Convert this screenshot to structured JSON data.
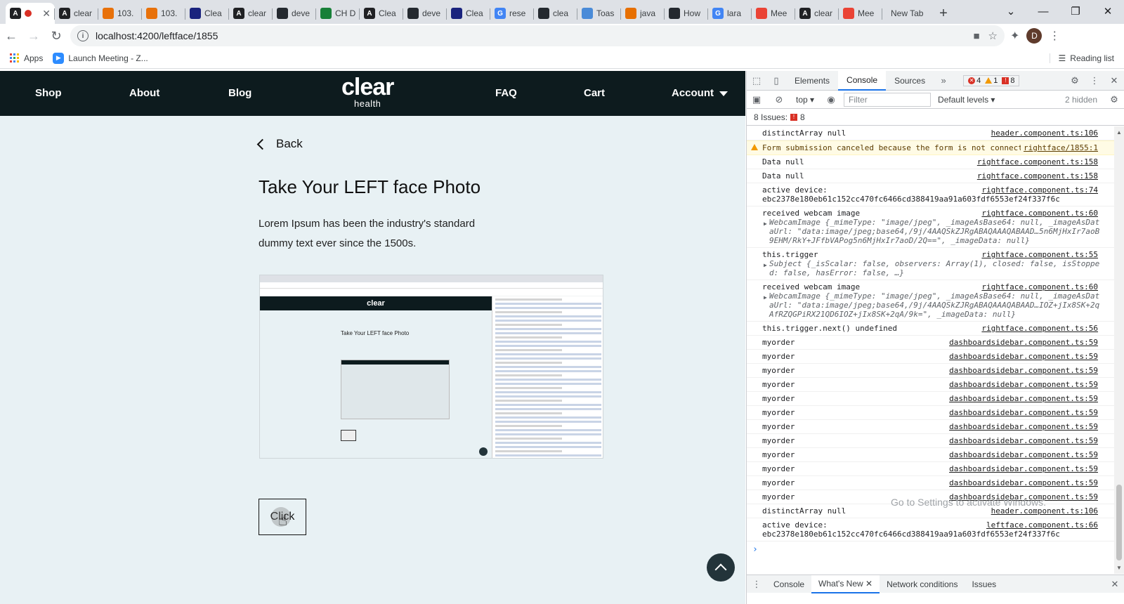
{
  "browser": {
    "tabs": [
      {
        "label": "",
        "icon": "A",
        "color": "#202124"
      },
      {
        "label": "clear",
        "icon": "A",
        "color": "#202124"
      },
      {
        "label": "103.",
        "icon": "",
        "color": "#e8710a"
      },
      {
        "label": "103.",
        "icon": "",
        "color": "#e8710a"
      },
      {
        "label": "Clea",
        "icon": "",
        "color": "#1a237e"
      },
      {
        "label": "clear",
        "icon": "A",
        "color": "#202124"
      },
      {
        "label": "deve",
        "icon": "",
        "color": "#24292f"
      },
      {
        "label": "CH D",
        "icon": "",
        "color": "#188038"
      },
      {
        "label": "Clea",
        "icon": "A",
        "color": "#202124"
      },
      {
        "label": "deve",
        "icon": "",
        "color": "#24292f"
      },
      {
        "label": "Clea",
        "icon": "",
        "color": "#1a237e"
      },
      {
        "label": "rese",
        "icon": "G",
        "color": "#4285f4"
      },
      {
        "label": "clea",
        "icon": "",
        "color": "#24292f"
      },
      {
        "label": "Toas",
        "icon": "",
        "color": "#4a8bd8"
      },
      {
        "label": "java",
        "icon": "",
        "color": "#e76f00"
      },
      {
        "label": "How",
        "icon": "",
        "color": "#24292f"
      },
      {
        "label": "lara",
        "icon": "G",
        "color": "#4285f4"
      },
      {
        "label": "Mee",
        "icon": "",
        "color": "#ea4335"
      },
      {
        "label": "clear",
        "icon": "A",
        "color": "#202124"
      },
      {
        "label": "Mee",
        "icon": "",
        "color": "#ea4335"
      }
    ],
    "new_tab_label": "New Tab",
    "url": "localhost:4200/leftface/1855",
    "avatar_letter": "D",
    "bookmarks": {
      "apps": "Apps",
      "meeting": "Launch Meeting - Z...",
      "reading_list": "Reading list"
    }
  },
  "site": {
    "nav": {
      "shop": "Shop",
      "about": "About",
      "blog": "Blog",
      "logo_big": "clear",
      "logo_small": "health",
      "faq": "FAQ",
      "cart": "Cart",
      "account": "Account"
    },
    "back_label": "Back",
    "heading": "Take Your LEFT face Photo",
    "description": "Lorem Ipsum has been the industry's standard dummy text ever since the 1500s.",
    "click_button": "Click"
  },
  "devtools": {
    "tabs": [
      "Elements",
      "Console",
      "Sources"
    ],
    "active_tab": "Console",
    "error_count": "4",
    "warning_count": "1",
    "issue_count": "8",
    "context": "top",
    "filter_placeholder": "Filter",
    "levels": "Default levels",
    "hidden": "2 hidden",
    "issues_label": "8 Issues:",
    "issues_badge": "8",
    "logs": [
      {
        "msg": "distinctArray null",
        "src": "header.component.ts:106"
      },
      {
        "msg": "Form submission canceled because the form is not connected",
        "src": "rightface/1855:1",
        "type": "warn"
      },
      {
        "msg": "Data null",
        "src": "rightface.component.ts:158"
      },
      {
        "msg": "Data null",
        "src": "rightface.component.ts:158"
      },
      {
        "msg": "active device:\nebc2378e180eb61c152cc470fc6466cd388419aa91a603fdf6553ef24f337f6c",
        "src": "rightface.component.ts:74"
      },
      {
        "msg": "received webcam image",
        "src": "rightface.component.ts:60",
        "detail": "WebcamImage {_mimeType: \"image/jpeg\", _imageAsBase64: null, _imageAsDataUrl: \"data:image/jpeg;base64,/9j/4AAQSkZJRgABAQAAAQABAAD…5n6MjHxIr7aoB9EHM/RkY+JFfbVAPog5n6MjHxIr7aoD/2Q==\", _imageData: null}"
      },
      {
        "msg": "this.trigger",
        "src": "rightface.component.ts:55",
        "detail": "Subject {_isScalar: false, observers: Array(1), closed: false, isStopped: false, hasError: false, …}"
      },
      {
        "msg": "received webcam image",
        "src": "rightface.component.ts:60",
        "detail": "WebcamImage {_mimeType: \"image/jpeg\", _imageAsBase64: null, _imageAsDataUrl: \"data:image/jpeg;base64,/9j/4AAQSkZJRgABAQAAAQABAAD…IOZ+jIx8SK+2qAfRZQGPiRX21QD6IOZ+jIx8SK+2qA/9k=\", _imageData: null}"
      },
      {
        "msg": "this.trigger.next() undefined",
        "src": "rightface.component.ts:56"
      },
      {
        "msg": "myorder",
        "src": "dashboardsidebar.component.ts:59"
      },
      {
        "msg": "myorder",
        "src": "dashboardsidebar.component.ts:59"
      },
      {
        "msg": "myorder",
        "src": "dashboardsidebar.component.ts:59"
      },
      {
        "msg": "myorder",
        "src": "dashboardsidebar.component.ts:59"
      },
      {
        "msg": "myorder",
        "src": "dashboardsidebar.component.ts:59"
      },
      {
        "msg": "myorder",
        "src": "dashboardsidebar.component.ts:59"
      },
      {
        "msg": "myorder",
        "src": "dashboardsidebar.component.ts:59"
      },
      {
        "msg": "myorder",
        "src": "dashboardsidebar.component.ts:59"
      },
      {
        "msg": "myorder",
        "src": "dashboardsidebar.component.ts:59"
      },
      {
        "msg": "myorder",
        "src": "dashboardsidebar.component.ts:59"
      },
      {
        "msg": "myorder",
        "src": "dashboardsidebar.component.ts:59"
      },
      {
        "msg": "myorder",
        "src": "dashboardsidebar.component.ts:59"
      },
      {
        "msg": "distinctArray null",
        "src": "header.component.ts:106"
      },
      {
        "msg": "active device:\nebc2378e180eb61c152cc470fc6466cd388419aa91a603fdf6553ef24f337f6c",
        "src": "leftface.component.ts:66"
      }
    ],
    "activate_windows": "Go to Settings to activate Windows.",
    "drawer_tabs": [
      "Console",
      "What's New",
      "Network conditions",
      "Issues"
    ],
    "drawer_active": "What's New"
  },
  "colors": {
    "site_nav_bg": "#0d1b1e",
    "page_bg": "#e8f1f4",
    "devtools_accent": "#1a73e8"
  }
}
